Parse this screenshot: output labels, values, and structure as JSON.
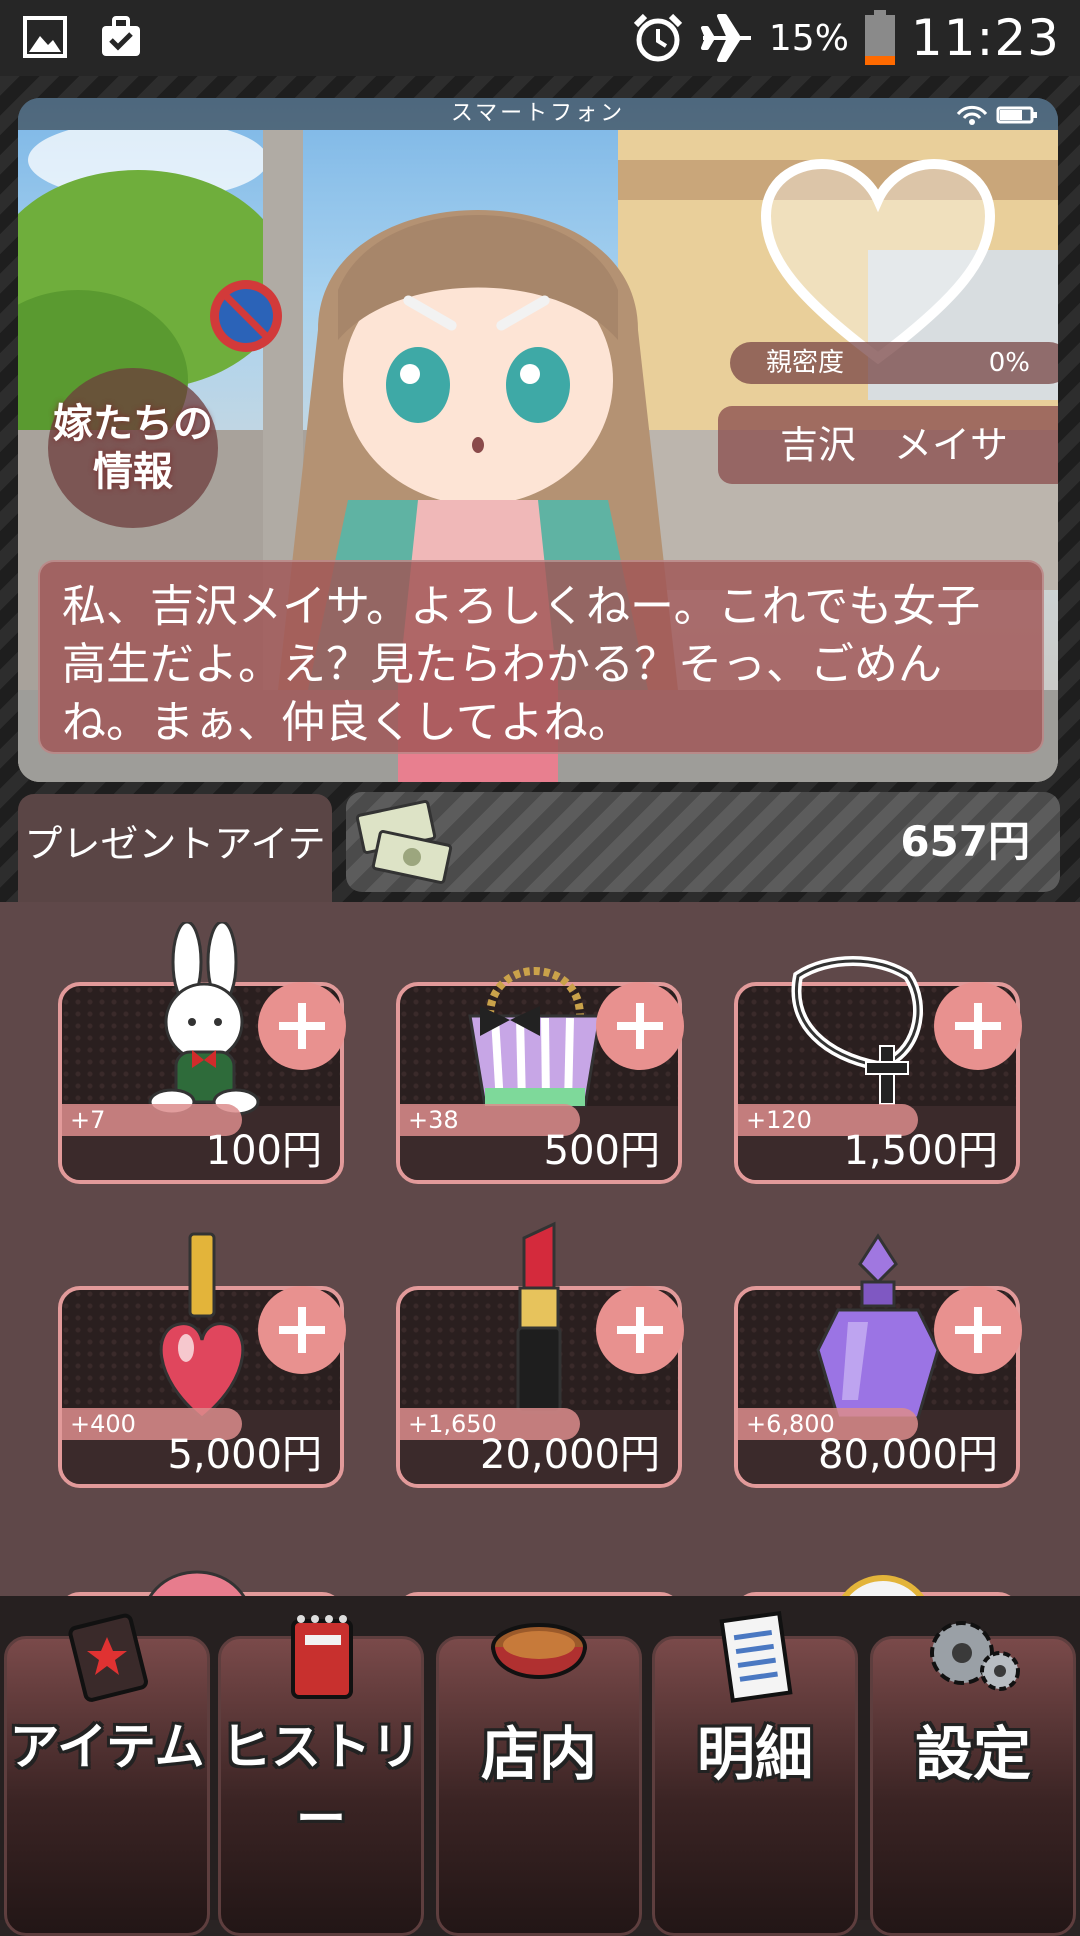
{
  "status_bar": {
    "battery_percent_label": "15%",
    "time": "11:23",
    "icons": [
      "image-icon",
      "briefcase-check-icon",
      "alarm-icon",
      "airplane-icon",
      "battery-icon"
    ]
  },
  "phone_screen": {
    "title": "スマートフォン",
    "info_badge": {
      "line1": "嫁たちの",
      "line2": "情報"
    },
    "affinity": {
      "label": "親密度",
      "value": "0%"
    },
    "character_name": "吉沢　メイサ",
    "dialog": "私、吉沢メイサ。よろしくねー。これでも女子高生だよ。え？見たらわかる？そっ、ごめんね。まぁ、仲良くしてよね。"
  },
  "present": {
    "tab_label": "プレゼントアイテム",
    "money": "657円"
  },
  "items": [
    {
      "bonus": "+7",
      "price": "100円",
      "icon": "rabbit-plush-icon"
    },
    {
      "bonus": "+38",
      "price": "500円",
      "icon": "handbag-icon"
    },
    {
      "bonus": "+120",
      "price": "1,500円",
      "icon": "cross-necklace-icon"
    },
    {
      "bonus": "+400",
      "price": "5,000円",
      "icon": "nail-polish-icon"
    },
    {
      "bonus": "+1,650",
      "price": "20,000円",
      "icon": "lipstick-icon"
    },
    {
      "bonus": "+6,800",
      "price": "80,000円",
      "icon": "perfume-icon"
    }
  ],
  "bottom_nav": [
    {
      "label": "アイテム",
      "icon": "item-card-icon"
    },
    {
      "label": "ヒストリー",
      "icon": "notebook-icon"
    },
    {
      "label": "店内",
      "icon": "food-bowl-icon"
    },
    {
      "label": "明細",
      "icon": "receipt-icon"
    },
    {
      "label": "設定",
      "icon": "gears-icon"
    }
  ],
  "colors": {
    "accent_pink": "#e8918f",
    "card_border": "#e29a9a",
    "panel": "#5f4849"
  }
}
